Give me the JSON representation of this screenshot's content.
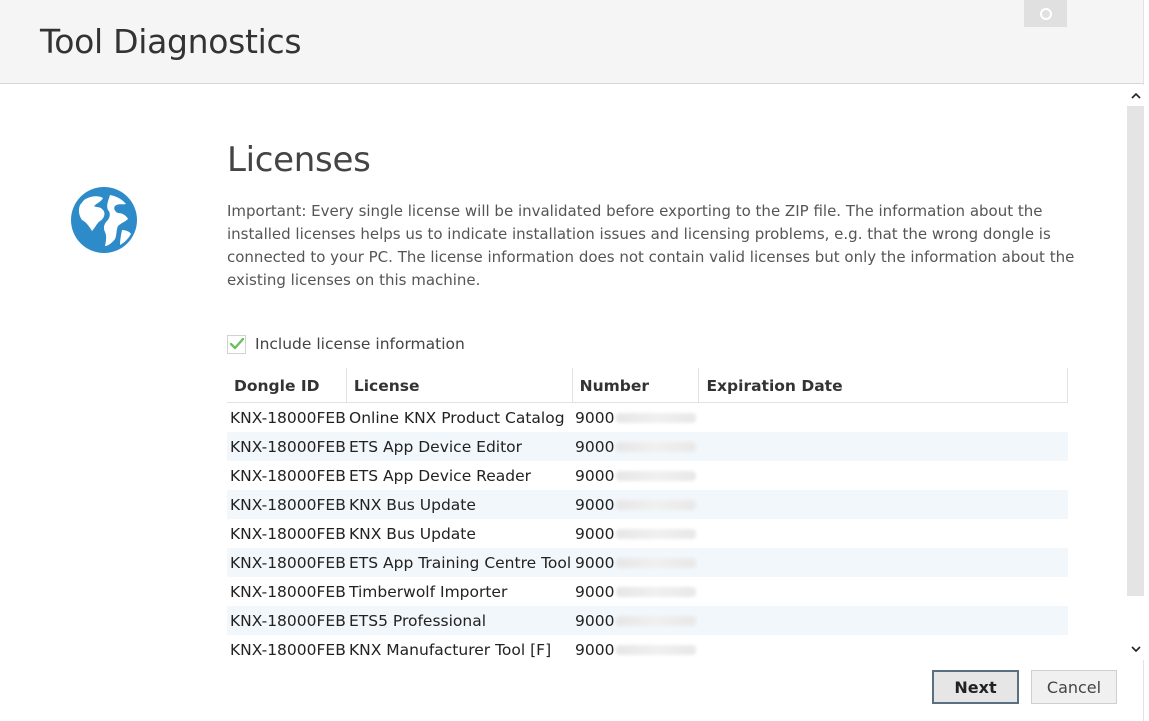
{
  "header": {
    "title": "Tool Diagnostics"
  },
  "section": {
    "title": "Licenses",
    "description": "Important: Every single license will be invalidated before exporting to the ZIP file. The information about the installed licenses helps us to indicate installation issues and licensing problems, e.g. that the wrong dongle is connected to your PC. The license information does not contain valid licenses but only the information about the existing licenses on this machine."
  },
  "include_checkbox": {
    "label": "Include license information",
    "checked": true
  },
  "table": {
    "columns": [
      "Dongle ID",
      "License",
      "Number",
      "Expiration Date"
    ],
    "rows": [
      {
        "dongle": "KNX-18000FEB",
        "license": "Online KNX Product Catalog",
        "number": "9000",
        "expiration": ""
      },
      {
        "dongle": "KNX-18000FEB",
        "license": "ETS App Device Editor",
        "number": "9000",
        "expiration": ""
      },
      {
        "dongle": "KNX-18000FEB",
        "license": "ETS App Device Reader",
        "number": "9000",
        "expiration": ""
      },
      {
        "dongle": "KNX-18000FEB",
        "license": "KNX Bus Update",
        "number": "9000",
        "expiration": ""
      },
      {
        "dongle": "KNX-18000FEB",
        "license": "KNX Bus Update",
        "number": "9000",
        "expiration": ""
      },
      {
        "dongle": "KNX-18000FEB",
        "license": "ETS App Training Centre Tool",
        "number": "9000",
        "expiration": ""
      },
      {
        "dongle": "KNX-18000FEB",
        "license": "Timberwolf Importer",
        "number": "9000",
        "expiration": ""
      },
      {
        "dongle": "KNX-18000FEB",
        "license": "ETS5 Professional",
        "number": "9000",
        "expiration": ""
      },
      {
        "dongle": "KNX-18000FEB",
        "license": "KNX Manufacturer Tool [F]",
        "number": "9000",
        "expiration": ""
      }
    ]
  },
  "buttons": {
    "next": "Next",
    "cancel": "Cancel"
  },
  "icons": {
    "section": "globe-icon",
    "check": "checkmark-icon"
  },
  "colors": {
    "globe": "#2e8bc9",
    "check": "#6cbf5f",
    "row_alt": "#f2f7fb",
    "next_border": "#5a6f80"
  }
}
